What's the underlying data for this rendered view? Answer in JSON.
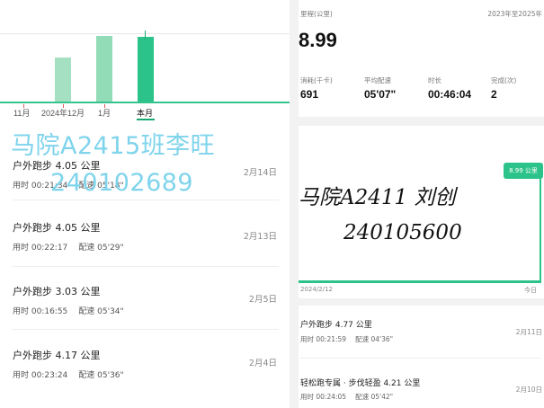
{
  "left": {
    "months": [
      {
        "label": "11月"
      },
      {
        "label": "2024年12月"
      },
      {
        "label": "1月"
      },
      {
        "label": "本月"
      }
    ],
    "watermark": {
      "line1": "马院A2415班李旺",
      "line2": "240102689"
    },
    "records": [
      {
        "title": "户外跑步 4.05 公里",
        "duration": "用时 00:21:34",
        "pace": "配速 05'18\"",
        "date": "2月14日"
      },
      {
        "title": "户外跑步 4.05 公里",
        "duration": "用时 00:22:17",
        "pace": "配速 05'29\"",
        "date": "2月13日"
      },
      {
        "title": "户外跑步 3.03 公里",
        "duration": "用时 00:16:55",
        "pace": "配速 05'34\"",
        "date": "2月5日"
      },
      {
        "title": "户外跑步 4.17 公里",
        "duration": "用时 00:23:24",
        "pace": "配速 05'36\"",
        "date": "2月4日"
      }
    ]
  },
  "right": {
    "distance_label": "里程(公里)",
    "period_label": "2023年至2025年",
    "distance_value": "8.99",
    "stats": [
      {
        "label": "消耗(千卡)",
        "value": "691"
      },
      {
        "label": "平均配速",
        "value": "05'07\""
      },
      {
        "label": "时长",
        "value": "00:46:04"
      },
      {
        "label": "完成(次)",
        "value": "2"
      }
    ],
    "handwriting": {
      "line1": "马院A2411 刘创",
      "line2": "240105600"
    },
    "chart_pill": "8.99 公里",
    "axis_start": "2024/2/12",
    "axis_end": "今日",
    "records": [
      {
        "title": "户外跑步 4.77 公里",
        "duration": "用时 00:21:59",
        "pace": "配速 04'36\"",
        "date": "2月11日"
      },
      {
        "title": "轻松跑专属 · 步伐轻盈 4.21 公里",
        "duration": "用时 00:24:05",
        "pace": "配速 05'42\"",
        "date": "2月10日"
      }
    ]
  }
}
